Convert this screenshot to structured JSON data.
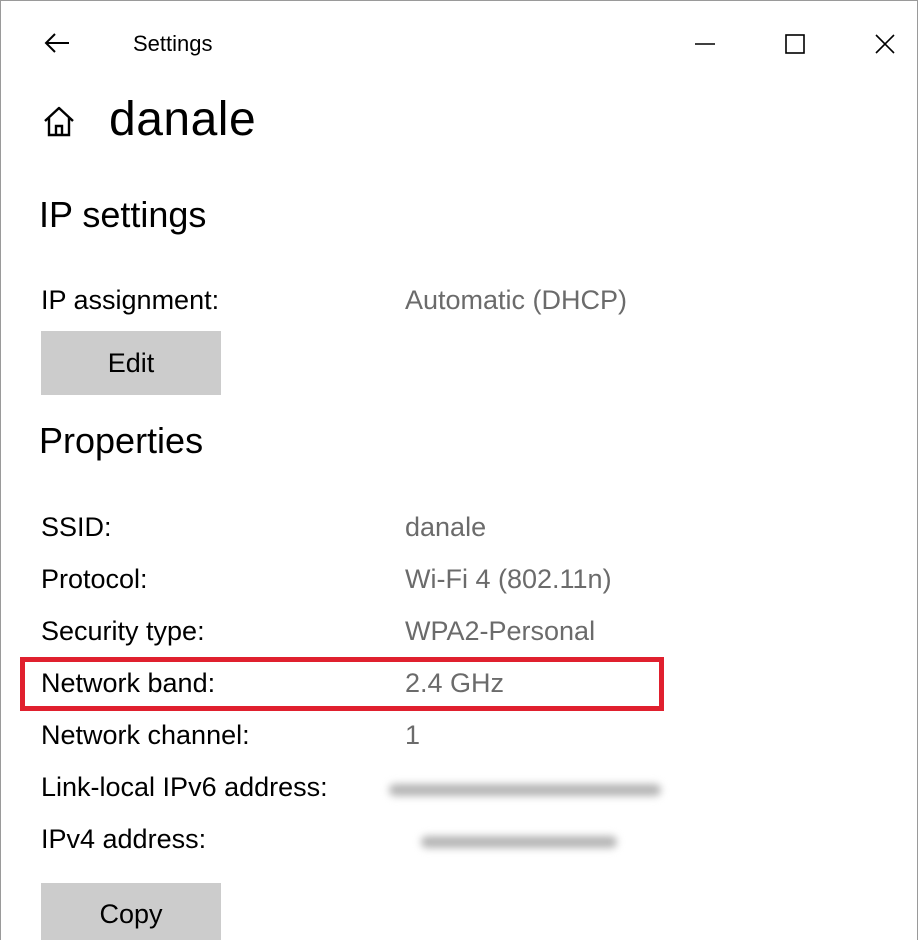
{
  "window": {
    "app_title": "Settings",
    "back_icon": "arrow-left-icon",
    "minimize_icon": "minimize-icon",
    "maximize_icon": "maximize-icon",
    "close_icon": "close-icon"
  },
  "header": {
    "home_icon": "home-icon",
    "title": "danale"
  },
  "ip_settings": {
    "section_title": "IP settings",
    "assignment_label": "IP assignment:",
    "assignment_value": "Automatic (DHCP)",
    "edit_label": "Edit"
  },
  "properties": {
    "section_title": "Properties",
    "rows": [
      {
        "label": "SSID:",
        "value": "danale"
      },
      {
        "label": "Protocol:",
        "value": "Wi-Fi 4 (802.11n)"
      },
      {
        "label": "Security type:",
        "value": "WPA2-Personal"
      },
      {
        "label": "Network band:",
        "value": "2.4 GHz"
      },
      {
        "label": "Network channel:",
        "value": "1"
      },
      {
        "label": "Link-local IPv6 address:",
        "value": ""
      },
      {
        "label": "IPv4 address:",
        "value": ""
      }
    ],
    "copy_label": "Copy"
  },
  "colors": {
    "highlight": "#e0202e",
    "button_bg": "#cccccc",
    "value_text": "#6b6b6b"
  }
}
